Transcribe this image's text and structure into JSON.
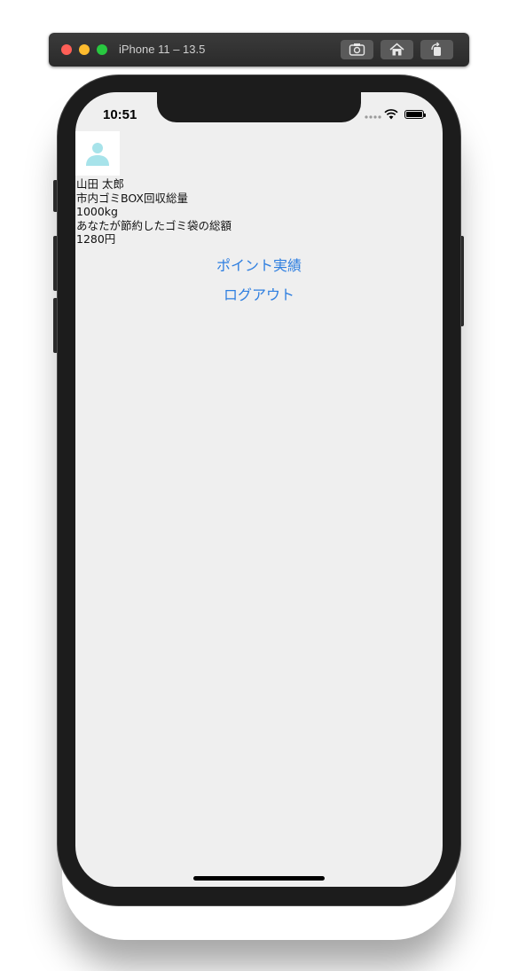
{
  "simulator": {
    "title": "iPhone 11 – 13.5",
    "buttons": [
      "screenshot-icon",
      "home-icon",
      "rotate-icon"
    ]
  },
  "status_bar": {
    "time": "10:51",
    "icons": [
      "signal-dots-icon",
      "wifi-icon",
      "battery-icon"
    ]
  },
  "profile": {
    "avatar_icon": "person-icon",
    "name": "山田 太郎",
    "box_total_label": "市内ゴミBOX回収総量",
    "box_total_value": "1000kg",
    "saved_label": "あなたが節約したゴミ袋の総額",
    "saved_value": "1280円"
  },
  "actions": {
    "points_label": "ポイント実績",
    "logout_label": "ログアウト"
  },
  "colors": {
    "screen_bg": "#efefef",
    "link": "#2f7fe0",
    "avatar_icon": "#a7e3ea"
  }
}
